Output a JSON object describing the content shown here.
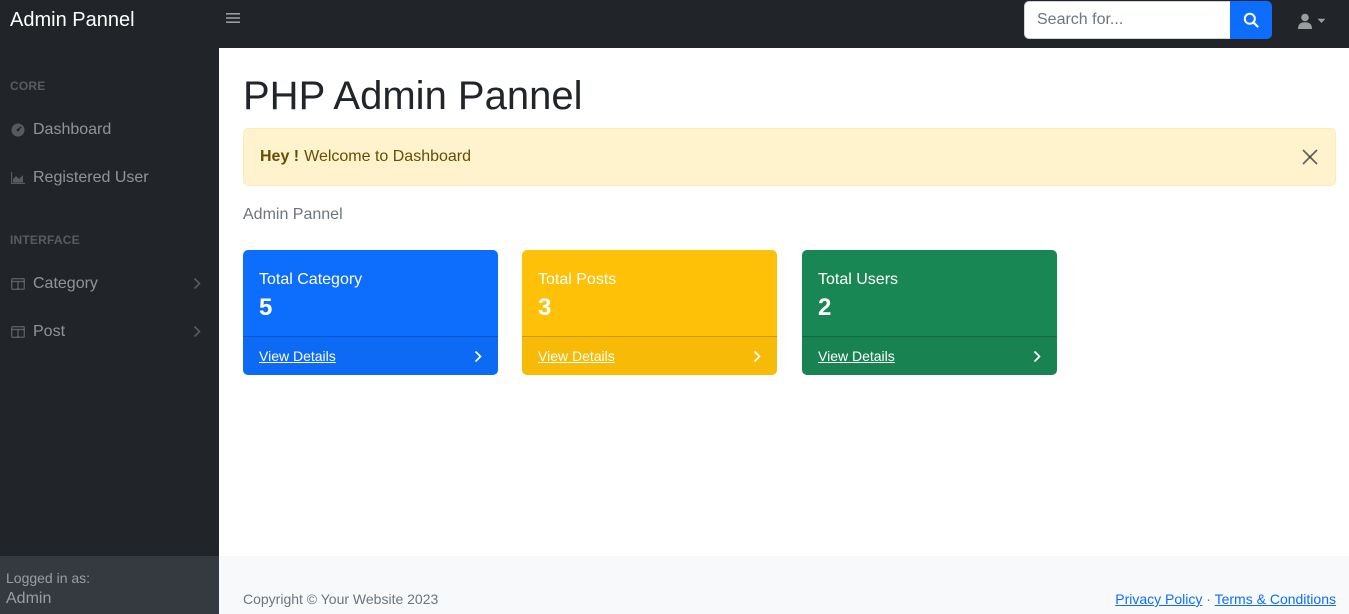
{
  "navbar": {
    "brand": "Admin Pannel",
    "search_placeholder": "Search for...",
    "search_value": "",
    "toggle_icon": "bars-icon",
    "search_icon": "search-icon",
    "user_icon": "user-icon"
  },
  "sidebar": {
    "heading_core": "CORE",
    "heading_interface": "INTERFACE",
    "items": [
      {
        "label": "Dashboard",
        "icon": "tachometer-icon"
      },
      {
        "label": "Registered User",
        "icon": "chart-area-icon"
      },
      {
        "label": "Category",
        "icon": "columns-icon"
      },
      {
        "label": "Post",
        "icon": "columns-icon"
      }
    ],
    "footer_small": "Logged in as:",
    "footer_user": "Admin"
  },
  "main": {
    "title": "PHP Admin Pannel",
    "alert_strong": "Hey !",
    "alert_text": "Welcome to Dashboard",
    "breadcrumb": "Admin Pannel",
    "cards": [
      {
        "title": "Total Category",
        "value": "5",
        "link": "View Details",
        "color": "#0d6efd"
      },
      {
        "title": "Total Posts",
        "value": "3",
        "link": "View Details",
        "color": "#ffc107"
      },
      {
        "title": "Total Users",
        "value": "2",
        "link": "View Details",
        "color": "#198754"
      }
    ]
  },
  "footer": {
    "copyright": "Copyright © Your Website 2023",
    "privacy": "Privacy Policy",
    "separator": "·",
    "terms": "Terms & Conditions"
  }
}
